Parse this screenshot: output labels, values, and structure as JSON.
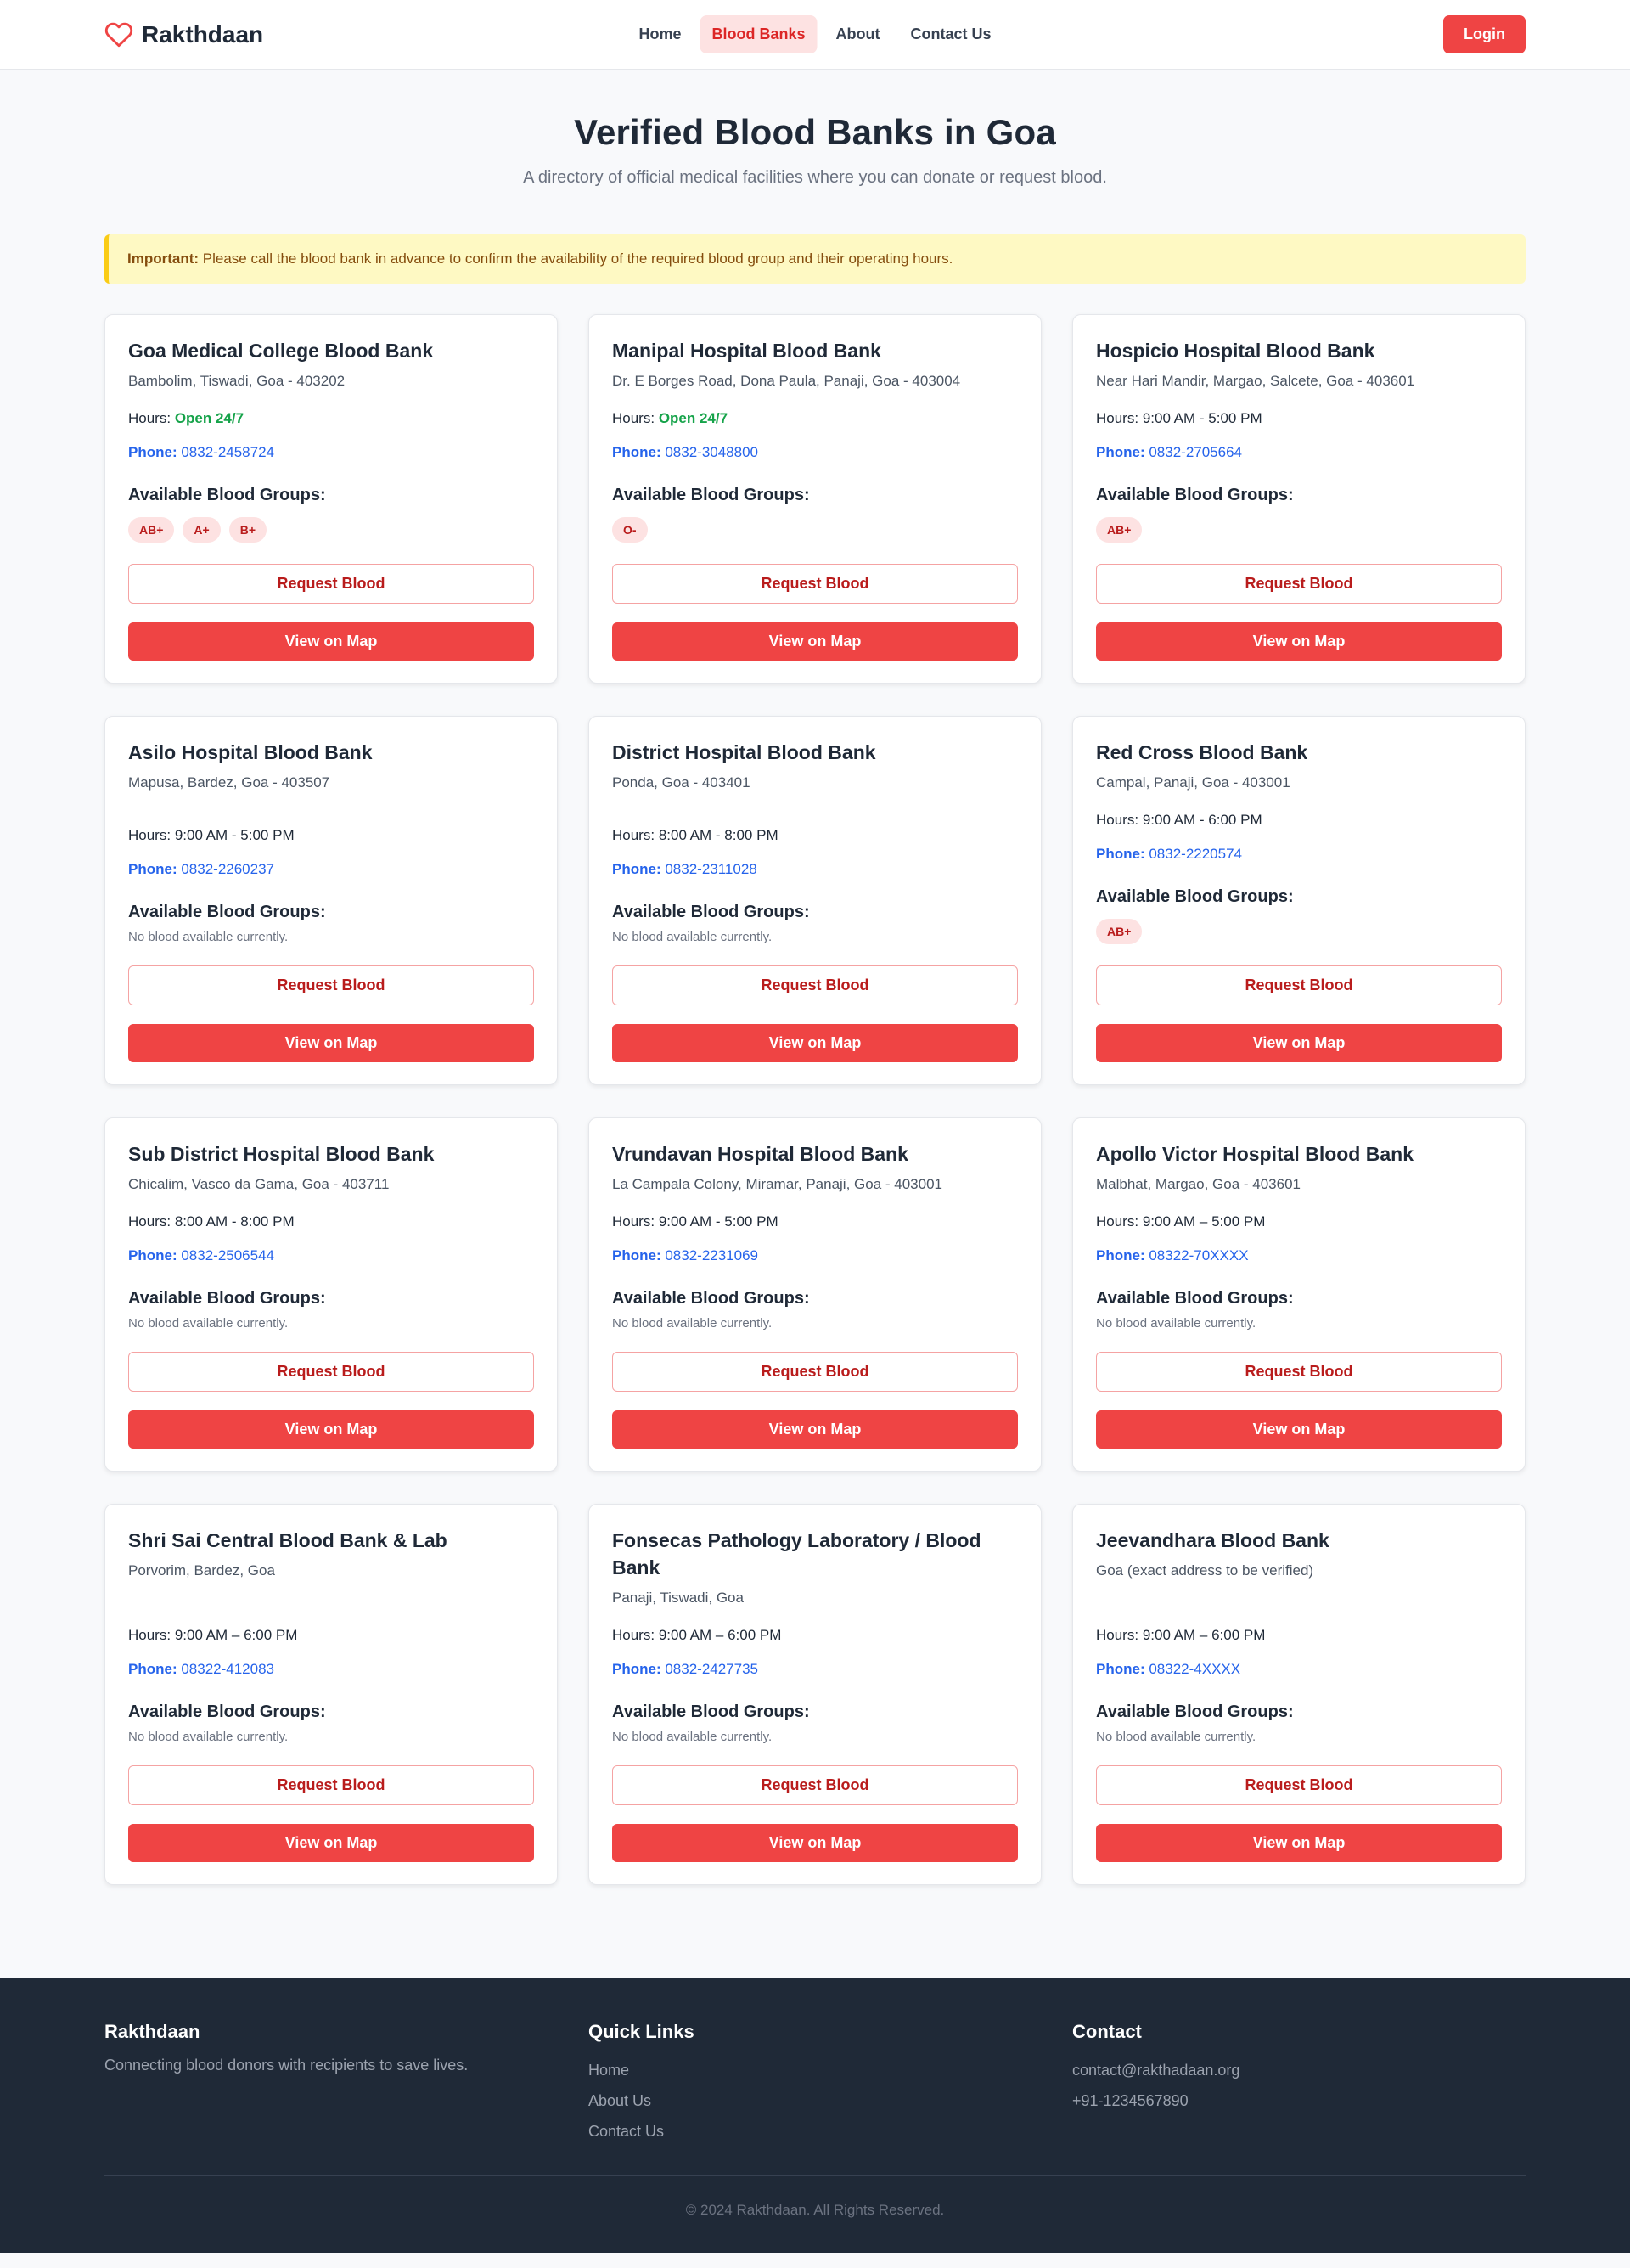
{
  "nav": {
    "brand": "Rakthdaan",
    "links": [
      "Home",
      "Blood Banks",
      "About",
      "Contact Us"
    ],
    "active_index": 1,
    "login_label": "Login"
  },
  "hero": {
    "title": "Verified Blood Banks in Goa",
    "subtitle": "A directory of official medical facilities where you can donate or request blood."
  },
  "notice": {
    "label": "Important:",
    "text": "Please call the blood bank in advance to confirm the availability of the required blood group and their operating hours."
  },
  "labels": {
    "hours": "Hours:",
    "phone": "Phone:",
    "groups_title": "Available Blood Groups:",
    "none": "No blood available currently.",
    "request": "Request Blood",
    "map": "View on Map"
  },
  "colors": {
    "accent": "#ef4444",
    "open": "#16a34a",
    "link": "#2563eb",
    "footer_bg": "#1f2937"
  },
  "banks": [
    {
      "name": "Goa Medical College Blood Bank",
      "address": "Bambolim, Tiswadi, Goa - 403202",
      "hours": "Open 24/7",
      "open247": true,
      "phone": "0832-2458724",
      "groups": [
        "AB+",
        "A+",
        "B+"
      ]
    },
    {
      "name": "Manipal Hospital Blood Bank",
      "address": "Dr. E Borges Road, Dona Paula, Panaji, Goa - 403004",
      "hours": "Open 24/7",
      "open247": true,
      "phone": "0832-3048800",
      "groups": [
        "O-"
      ]
    },
    {
      "name": "Hospicio Hospital Blood Bank",
      "address": "Near Hari Mandir, Margao, Salcete, Goa - 403601",
      "hours": "9:00 AM - 5:00 PM",
      "open247": false,
      "phone": "0832-2705664",
      "groups": [
        "AB+"
      ]
    },
    {
      "name": "Asilo Hospital Blood Bank",
      "address": "Mapusa, Bardez, Goa - 403507",
      "hours": "9:00 AM - 5:00 PM",
      "open247": false,
      "phone": "0832-2260237",
      "groups": []
    },
    {
      "name": "District Hospital Blood Bank",
      "address": "Ponda, Goa - 403401",
      "hours": "8:00 AM - 8:00 PM",
      "open247": false,
      "phone": "0832-2311028",
      "groups": []
    },
    {
      "name": "Red Cross Blood Bank",
      "address": "Campal, Panaji, Goa - 403001",
      "hours": "9:00 AM - 6:00 PM",
      "open247": false,
      "phone": "0832-2220574",
      "groups": [
        "AB+"
      ]
    },
    {
      "name": "Sub District Hospital Blood Bank",
      "address": "Chicalim, Vasco da Gama, Goa - 403711",
      "hours": "8:00 AM - 8:00 PM",
      "open247": false,
      "phone": "0832-2506544",
      "groups": []
    },
    {
      "name": "Vrundavan Hospital Blood Bank",
      "address": "La Campala Colony, Miramar, Panaji, Goa - 403001",
      "hours": "9:00 AM - 5:00 PM",
      "open247": false,
      "phone": "0832-2231069",
      "groups": []
    },
    {
      "name": "Apollo Victor Hospital Blood Bank",
      "address": "Malbhat, Margao, Goa - 403601",
      "hours": "9:00 AM – 5:00 PM",
      "open247": false,
      "phone": "08322-70XXXX",
      "groups": []
    },
    {
      "name": "Shri Sai Central Blood Bank & Lab",
      "address": "Porvorim, Bardez, Goa",
      "hours": "9:00 AM – 6:00 PM",
      "open247": false,
      "phone": "08322-412083",
      "groups": []
    },
    {
      "name": "Fonsecas Pathology Laboratory / Blood Bank",
      "address": "Panaji, Tiswadi, Goa",
      "hours": "9:00 AM – 6:00 PM",
      "open247": false,
      "phone": "0832-2427735",
      "groups": []
    },
    {
      "name": "Jeevandhara Blood Bank",
      "address": "Goa (exact address to be verified)",
      "hours": "9:00 AM – 6:00 PM",
      "open247": false,
      "phone": "08322-4XXXX",
      "groups": []
    }
  ],
  "footer": {
    "brand_title": "Rakthdaan",
    "brand_text": "Connecting blood donors with recipients to save lives.",
    "links_title": "Quick Links",
    "links": [
      "Home",
      "About Us",
      "Contact Us"
    ],
    "contact_title": "Contact",
    "email": "contact@rakthadaan.org",
    "phone": "+91-1234567890",
    "copyright": "© 2024 Rakthdaan. All Rights Reserved."
  }
}
